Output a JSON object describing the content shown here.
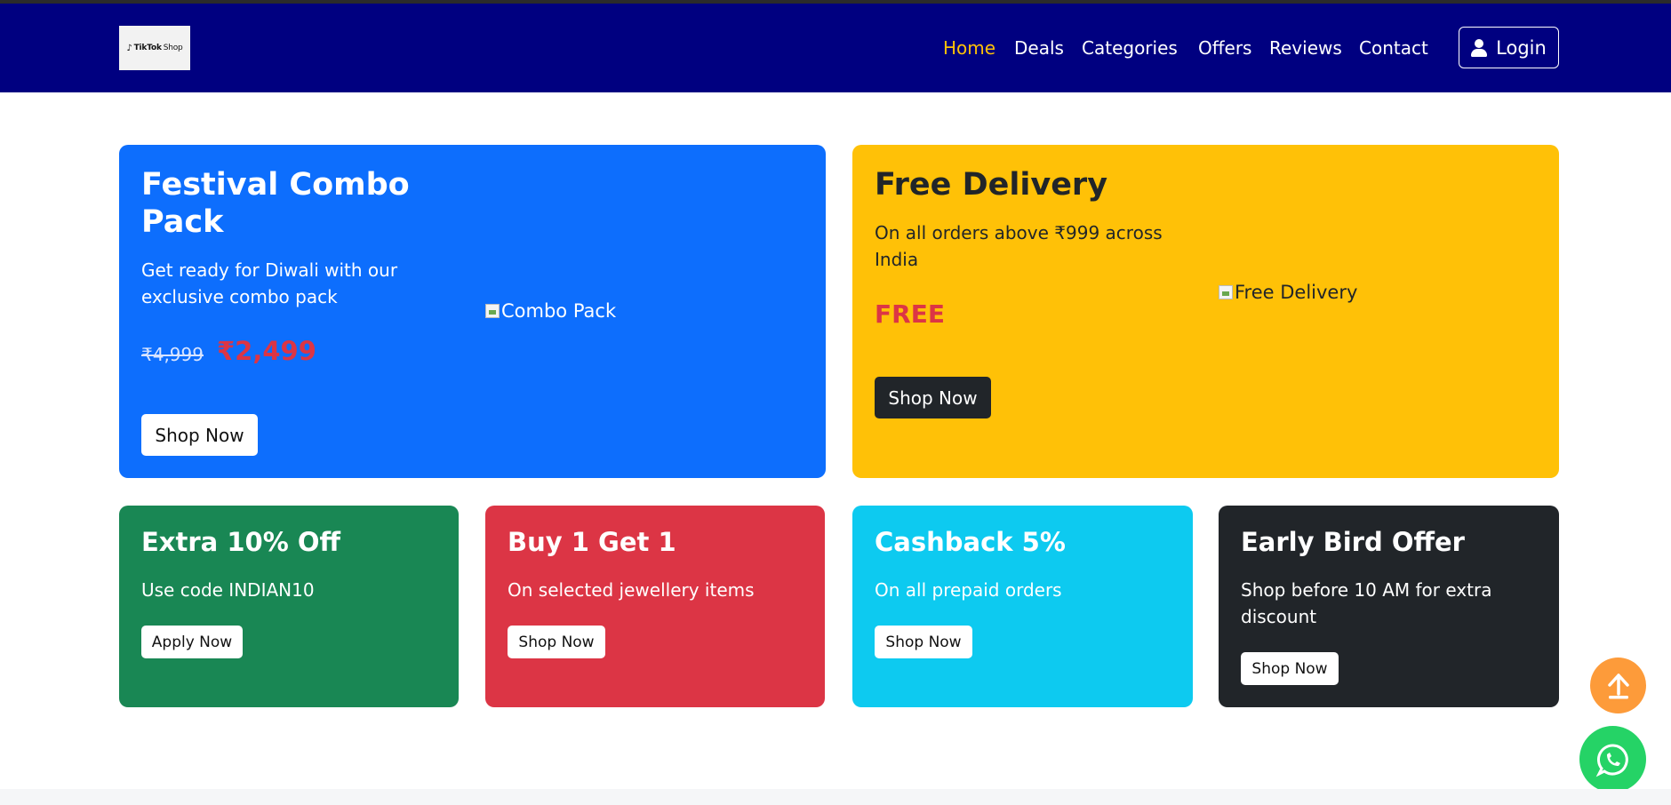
{
  "brand": {
    "logo_text_1": "TikTok",
    "logo_text_2": "Shop"
  },
  "nav": {
    "items": [
      {
        "label": "Home"
      },
      {
        "label": "Deals"
      },
      {
        "label": "Categories"
      },
      {
        "label": "Offers"
      },
      {
        "label": "Reviews"
      },
      {
        "label": "Contact"
      }
    ],
    "login_label": "Login"
  },
  "promo_combo": {
    "title": "Festival Combo Pack",
    "subtitle": "Get ready for Diwali with our exclusive combo pack",
    "old_price": "₹4,999",
    "new_price": "₹2,499",
    "image_alt": "Combo Pack",
    "button": "Shop Now"
  },
  "promo_delivery": {
    "title": "Free Delivery",
    "subtitle": "On all orders above ₹999 across India",
    "tag": "FREE",
    "image_alt": "Free Delivery",
    "button": "Shop Now"
  },
  "offers": [
    {
      "title": "Extra 10% Off",
      "subtitle": "Use code INDIAN10",
      "button": "Apply Now",
      "color": "#198754"
    },
    {
      "title": "Buy 1 Get 1",
      "subtitle": "On selected jewellery items",
      "button": "Shop Now",
      "color": "#dc3545"
    },
    {
      "title": "Cashback 5%",
      "subtitle": "On all prepaid orders",
      "button": "Shop Now",
      "color": "#0dcaf0"
    },
    {
      "title": "Early Bird Offer",
      "subtitle": "Shop before 10 AM for extra discount",
      "button": "Shop Now",
      "color": "#212529"
    }
  ],
  "icons": {
    "scroll_top": "arrow-up-icon",
    "whatsapp": "whatsapp-icon",
    "user": "user-icon"
  },
  "colors": {
    "navbar": "#000080",
    "active_nav": "#ffc107",
    "primary": "#0d6efd",
    "warning": "#ffc107"
  }
}
